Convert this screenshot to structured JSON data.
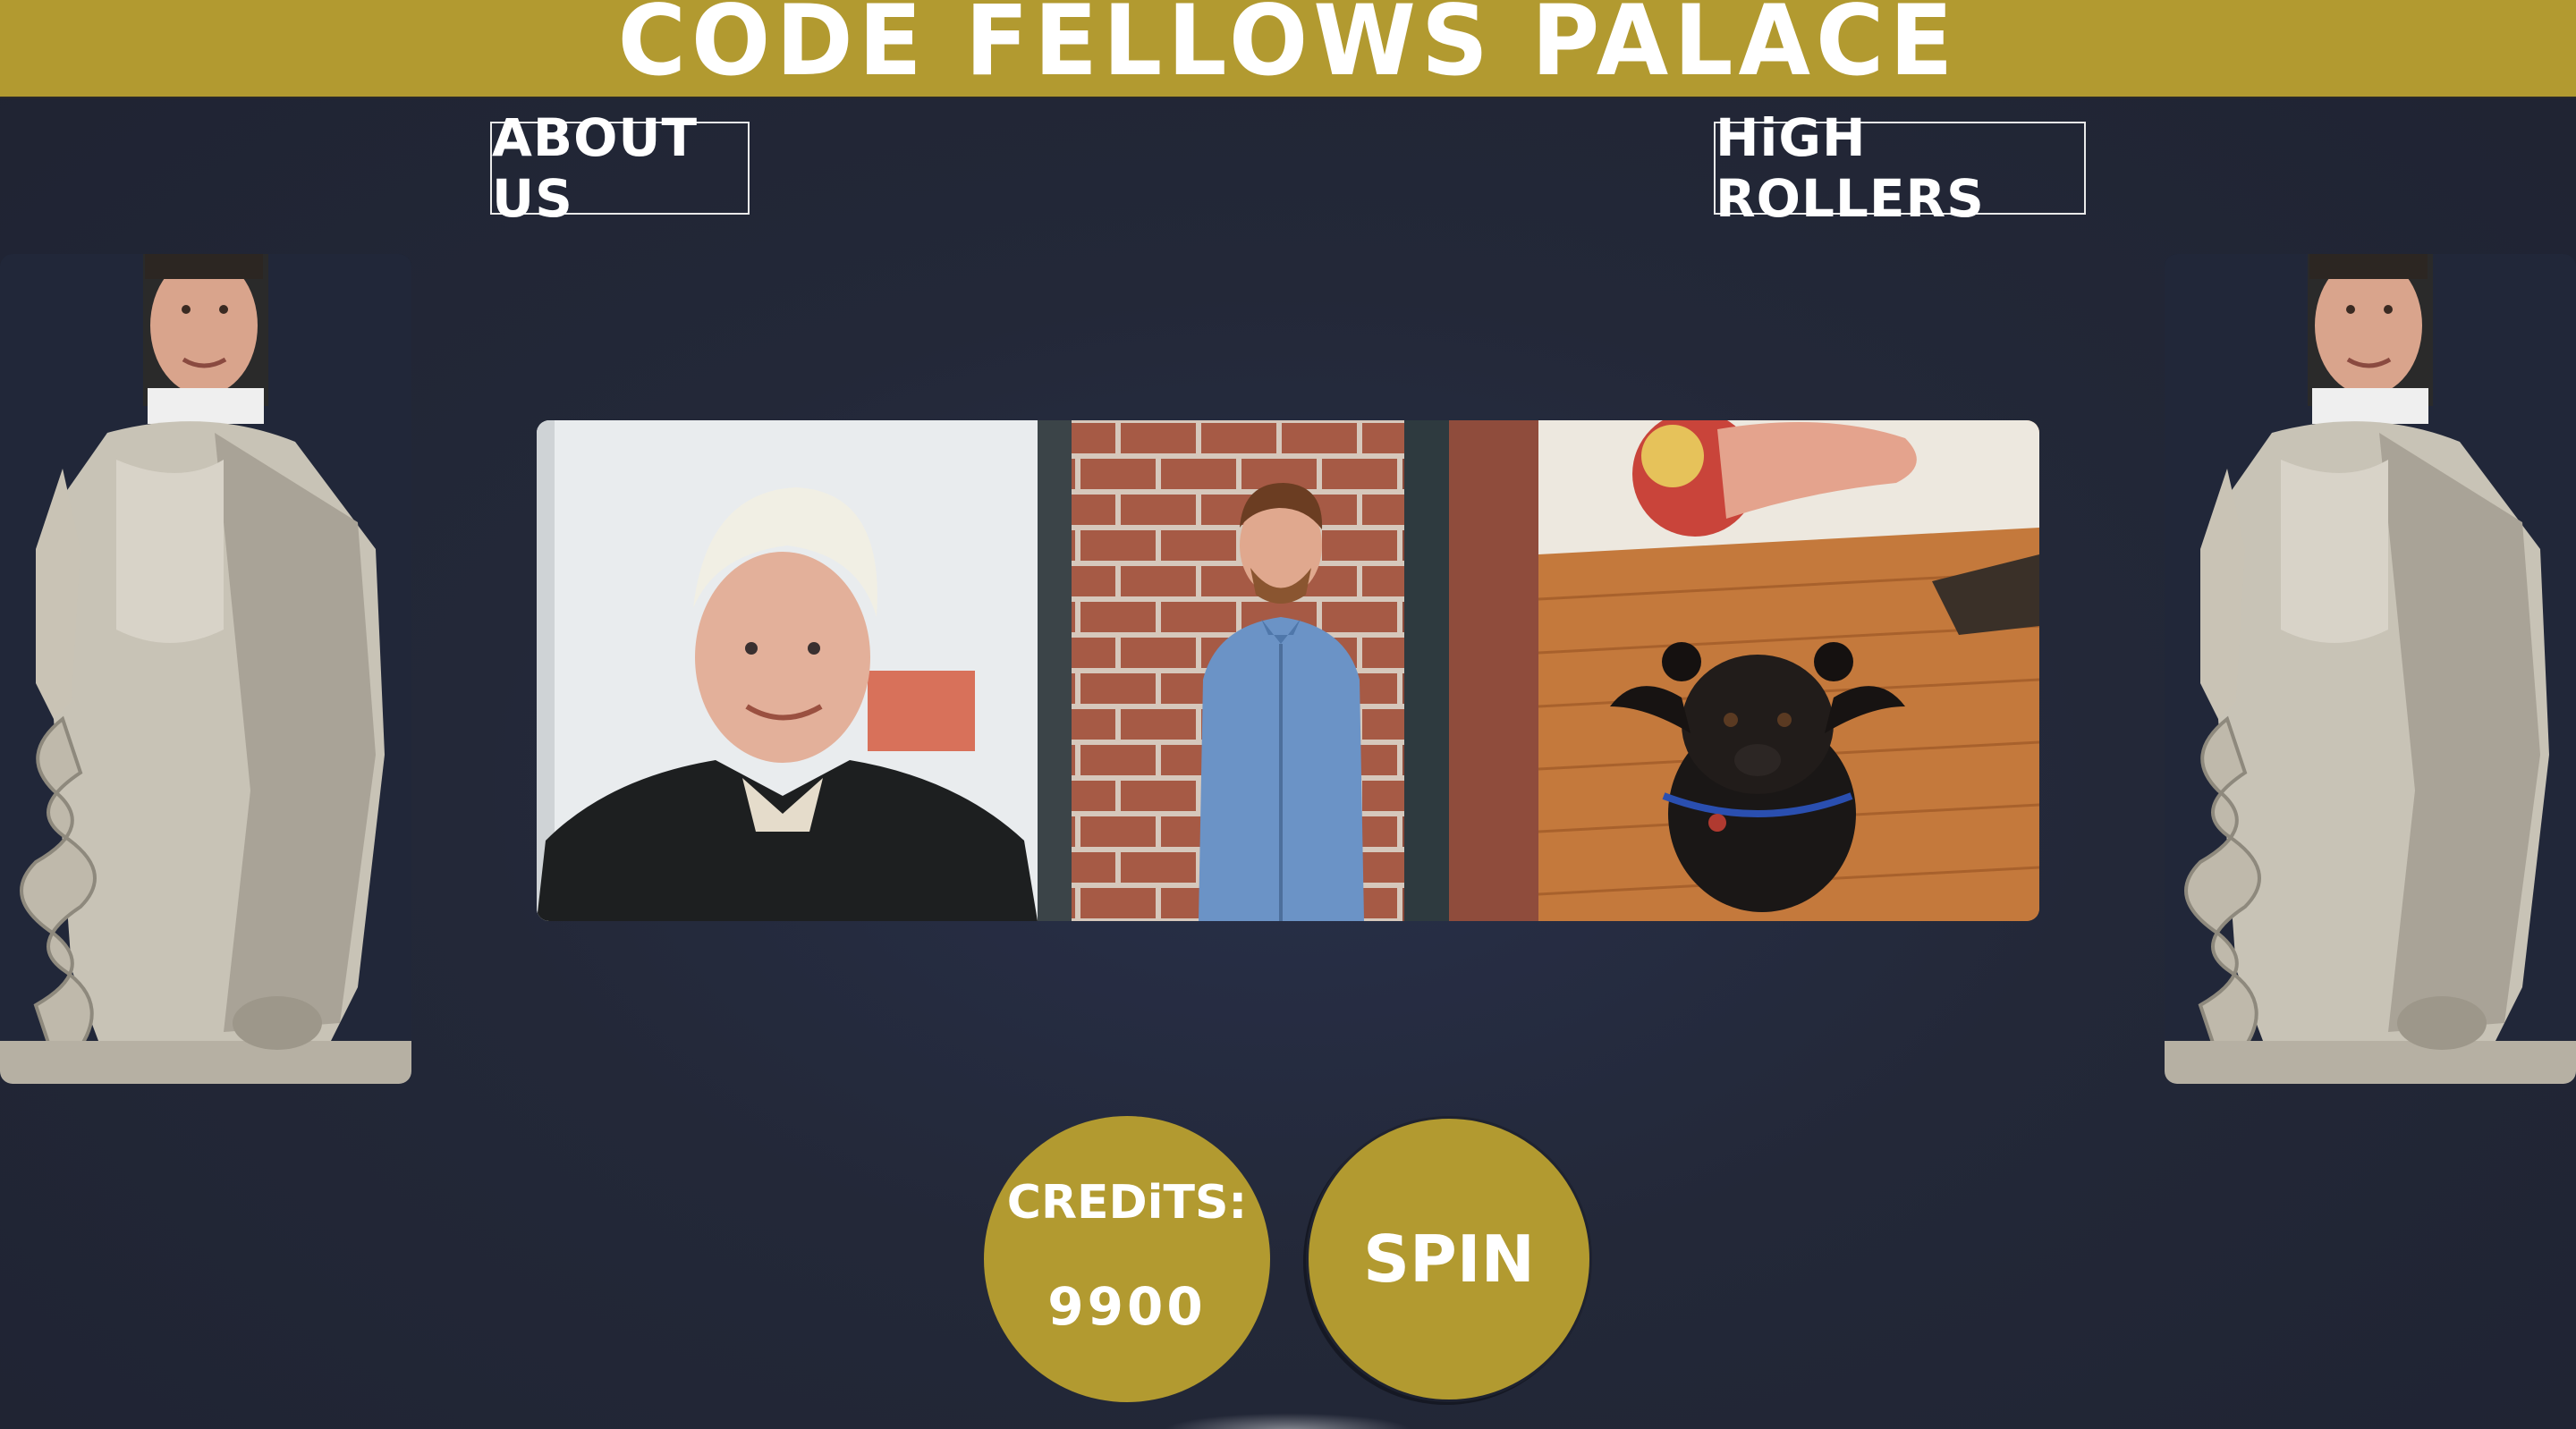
{
  "header": {
    "title": "CODE FELLOWS PALACE"
  },
  "nav": {
    "about_label": "ABOUT US",
    "rollers_label": "HiGH ROLLERS"
  },
  "reels": [
    {
      "image": "man-gray-hair-black-shirt"
    },
    {
      "image": "man-blue-shirt-brick-wall"
    },
    {
      "image": "black-dog-on-wood-floor"
    }
  ],
  "statues": {
    "image": "toga-statue-with-face"
  },
  "credits": {
    "label": "CREDiTS:",
    "value": "9900"
  },
  "spin": {
    "label": "SPIN"
  },
  "colors": {
    "accent": "#b29a30",
    "background": "#232838",
    "text": "#ffffff"
  }
}
